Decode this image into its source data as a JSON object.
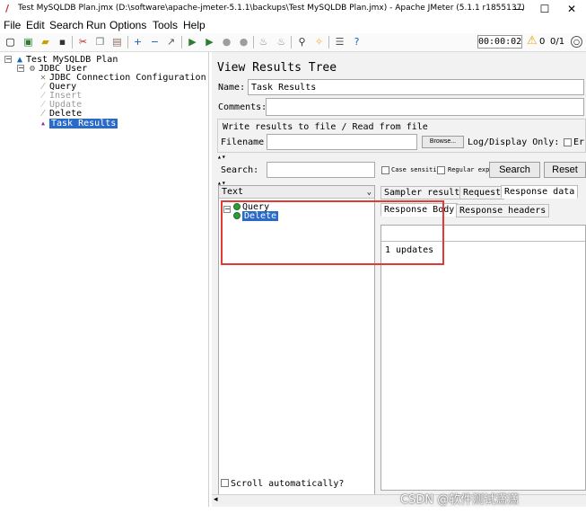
{
  "window": {
    "title": "Test MySQLDB Plan.jmx (D:\\software\\apache-jmeter-5.1.1\\backups\\Test MySQLDB Plan.jmx) - Apache JMeter (5.1.1 r1855137)",
    "min": "—",
    "max": "☐",
    "close": "✕"
  },
  "menu": [
    "File",
    "Edit",
    "Search",
    "Run",
    "Options",
    "Tools",
    "Help"
  ],
  "toolbar": {
    "icons": [
      "new-icon",
      "templates-icon",
      "open-icon",
      "save-icon",
      "cut-icon",
      "copy-icon",
      "paste-icon",
      "expand-icon",
      "collapse-icon",
      "toggle-icon",
      "start-icon",
      "start-no-pause-icon",
      "stop-icon",
      "shutdown-icon",
      "clear-icon",
      "clear-all-icon",
      "search-icon",
      "reset-search-icon",
      "function-helper-icon",
      "help-icon"
    ],
    "timer": "00:00:02",
    "warning_count": "0",
    "threads": "0/1"
  },
  "tree": {
    "plan": "Test MySQLDB Plan",
    "thread_group": "JDBC User",
    "items": [
      {
        "label": "JDBC Connection Configuration",
        "enabled": true
      },
      {
        "label": "Query",
        "enabled": true
      },
      {
        "label": "Insert",
        "enabled": false
      },
      {
        "label": "Update",
        "enabled": false
      },
      {
        "label": "Delete",
        "enabled": true
      },
      {
        "label": "Task Results",
        "enabled": true,
        "selected": true
      }
    ]
  },
  "panel": {
    "heading": "View Results Tree",
    "name_label": "Name:",
    "name_value": "Task Results",
    "comments_label": "Comments:",
    "comments_value": "",
    "file_section": "Write results to file / Read from file",
    "filename_label": "Filename",
    "filename_value": "",
    "browse_label": "Browse...",
    "log_display": "Log/Display Only:",
    "errors_label": "Er",
    "search_label": "Search:",
    "search_value": "",
    "case_sensitive": "Case sensitive",
    "regular_exp": "Regular exp.",
    "search_button": "Search",
    "reset_button": "Reset"
  },
  "results": {
    "header": "Text",
    "samples": [
      {
        "label": "Query",
        "selected": false
      },
      {
        "label": "Delete",
        "selected": true
      }
    ],
    "scroll_auto": "Scroll automatically?"
  },
  "details": {
    "tabs": [
      "Sampler result",
      "Request",
      "Response data"
    ],
    "subtabs": [
      "Response Body",
      "Response headers"
    ],
    "response_body": "1 updates"
  },
  "watermark": "CSDN @软件测试潇潇"
}
